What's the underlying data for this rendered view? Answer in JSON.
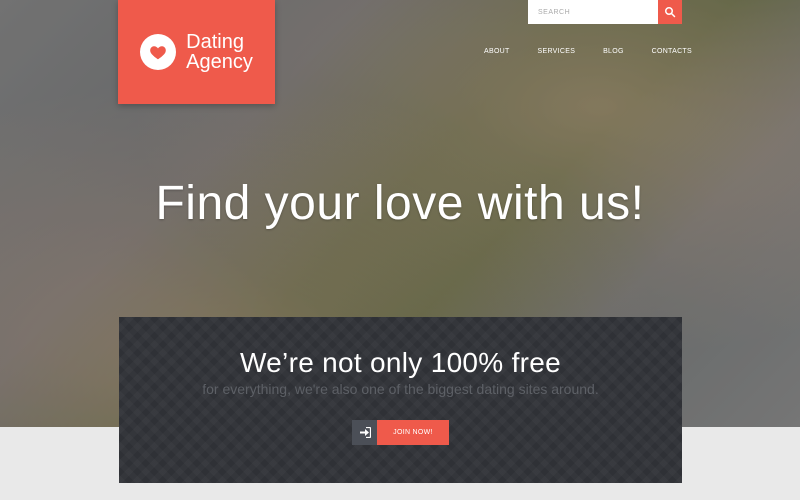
{
  "logo": {
    "line1": "Dating",
    "line2": "Agency",
    "icon": "heart-icon"
  },
  "search": {
    "placeholder": "SEARCH",
    "icon": "search-icon"
  },
  "nav": {
    "items": [
      "ABOUT",
      "SERVICES",
      "BLOG",
      "CONTACTS"
    ]
  },
  "hero": {
    "headline": "Find your love with us!"
  },
  "promo": {
    "title": "We’re not only 100% free",
    "subtitle": "for everything, we're also one of the biggest dating sites around.",
    "cta_label": "JOIN NOW!",
    "cta_icon": "sign-in-icon"
  },
  "colors": {
    "accent": "#ef5a4b",
    "panel": "#2f3136"
  }
}
